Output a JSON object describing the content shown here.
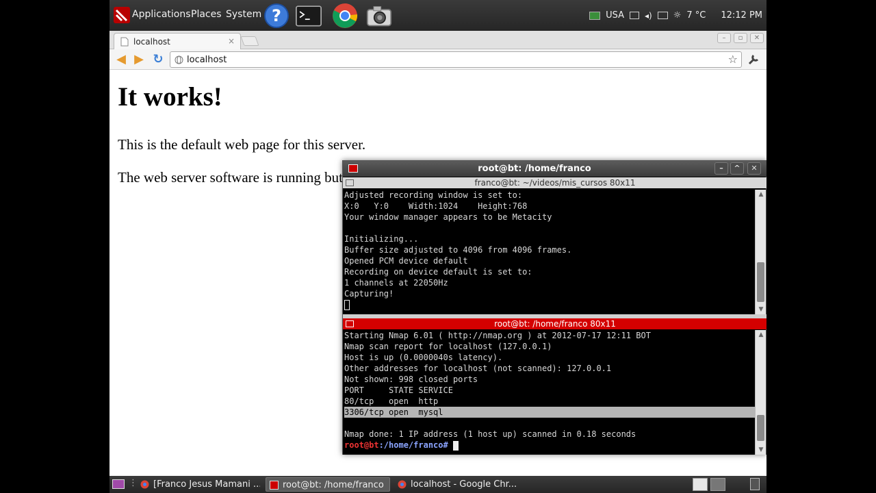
{
  "top_panel": {
    "menus": [
      "Applications",
      "Places",
      "System"
    ],
    "launchers": [
      "help-icon",
      "terminal-icon",
      "chrome-icon",
      "camera-icon"
    ],
    "tray": {
      "keyboard_layout": "USA",
      "weather": "7 °C",
      "clock": "12:12 PM"
    }
  },
  "browser": {
    "tab_title": "localhost",
    "tab_close": "×",
    "url": "localhost",
    "page": {
      "heading": "It works!",
      "para1": "This is the default web page for this server.",
      "para2": "The web server software is running but no content has been added, yet."
    }
  },
  "terminal": {
    "title": "root@bt: /home/franco",
    "pane1_title": "franco@bt: ~/videos/mis_cursos 80x11",
    "pane1_lines": [
      "Adjusted recording window is set to:",
      "X:0   Y:0    Width:1024    Height:768",
      "Your window manager appears to be Metacity",
      "",
      "Initializing...",
      "Buffer size adjusted to 4096 from 4096 frames.",
      "Opened PCM device default",
      "Recording on device default is set to:",
      "1 channels at 22050Hz",
      "Capturing!"
    ],
    "pane2_title": "root@bt: /home/franco 80x11",
    "pane2_lines": [
      "Starting Nmap 6.01 ( http://nmap.org ) at 2012-07-17 12:11 BOT",
      "Nmap scan report for localhost (127.0.0.1)",
      "Host is up (0.0000040s latency).",
      "Other addresses for localhost (not scanned): 127.0.0.1",
      "Not shown: 998 closed ports",
      "PORT     STATE SERVICE",
      "80/tcp   open  http",
      "3306/tcp open  mysql",
      "",
      "Nmap done: 1 IP address (1 host up) scanned in 0.18 seconds"
    ],
    "prompt_user": "root@bt",
    "prompt_path": ":/home/franco#"
  },
  "taskbar": {
    "tasks": [
      "[Franco Jesus Mamani ...",
      "root@bt: /home/franco",
      "localhost - Google Chr..."
    ]
  },
  "colors": {
    "pane2_title_bg": "#d40000",
    "prompt_red": "#ee3333",
    "prompt_blue": "#8ba4ff"
  }
}
